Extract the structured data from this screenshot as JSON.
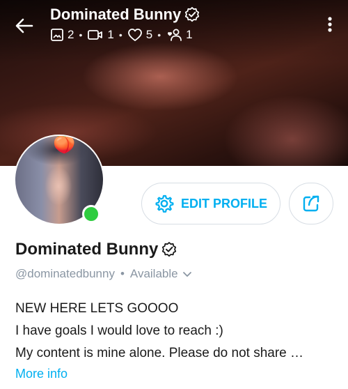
{
  "header": {
    "name": "Dominated Bunny",
    "stats": {
      "photos": "2",
      "videos": "1",
      "likes": "5",
      "fans": "1"
    }
  },
  "profile": {
    "name": "Dominated Bunny",
    "handle": "@dominatedbunny",
    "status": "Available",
    "bio": [
      "NEW HERE LETS GOOOO",
      "I have goals I would love to reach :)",
      "My content is mine alone. Please do not share …"
    ],
    "more_info": "More info",
    "avatar_emoji": "🍑"
  },
  "actions": {
    "edit_profile": "EDIT PROFILE"
  },
  "colors": {
    "accent": "#00aff0",
    "online": "#2ecc40",
    "muted": "#8a96a3"
  },
  "icons": [
    "back-arrow-icon",
    "image-icon",
    "video-icon",
    "heart-icon",
    "fans-icon",
    "kebab-menu-icon",
    "verified-icon",
    "gear-icon",
    "share-icon",
    "chevron-down-icon"
  ]
}
